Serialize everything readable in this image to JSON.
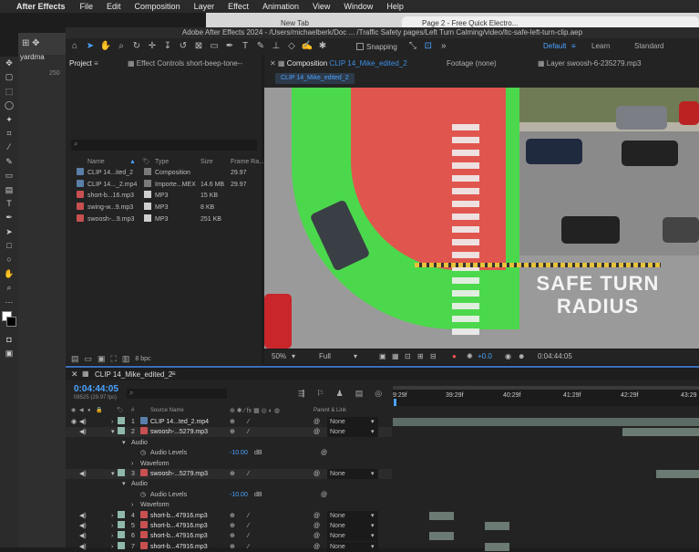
{
  "macmenu": {
    "apple": "",
    "app": "After Effects",
    "items": [
      "File",
      "Edit",
      "Composition",
      "Layer",
      "Effect",
      "Animation",
      "View",
      "Window",
      "Help"
    ]
  },
  "browser": {
    "tabs": [
      "New Tab",
      "Page 2 - Free Quick Electro..."
    ]
  },
  "ae": {
    "title": "Adobe After Effects 2024 - /Users/michaelberk/Doc ... /Traffic Safety pages/Left Turn Calming/video/ltc-safe-left-turn-clip.aep",
    "snapping": "Snapping",
    "workspaces": [
      "Default",
      "Learn",
      "Standard"
    ],
    "side_label": "yardma",
    "side_num": "250"
  },
  "project": {
    "tab": "Project",
    "effect_controls": "Effect Controls short-beep-tone--",
    "search_placeholder": "",
    "columns": [
      "Name",
      "Type",
      "Size",
      "Frame Ra..."
    ],
    "rows": [
      {
        "name": "CLIP 14...ited_2",
        "type": "Composition",
        "size": "",
        "fps": "29.97",
        "color": "#7a7a7a"
      },
      {
        "name": "CLIP 14..._2.mp4",
        "type": "Importe...MEX",
        "size": "14.6 MB",
        "fps": "29.97",
        "color": "#7a7a7a"
      },
      {
        "name": "short-b...16.mp3",
        "type": "MP3",
        "size": "15 KB",
        "fps": "",
        "color": "#cfcfcf"
      },
      {
        "name": "swing-w...9.mp3",
        "type": "MP3",
        "size": "8 KB",
        "fps": "",
        "color": "#cfcfcf"
      },
      {
        "name": "swoosh-...9.mp3",
        "type": "MP3",
        "size": "251 KB",
        "fps": "",
        "color": "#cfcfcf"
      }
    ],
    "bpc": "8 bpc"
  },
  "composition": {
    "tab": "Composition",
    "tab_name": "CLIP 14_Mike_edited_2",
    "footage": "Footage (none)",
    "layer_tab": "Layer swoosh-6-235279.mp3",
    "breadcrumb": "CLIP 14_Mike_edited_2",
    "overlay_line1": "SAFE TURN",
    "overlay_line2": "RADIUS",
    "zoom": "50%",
    "resolution": "Full",
    "exposure": "+0.0",
    "timecode": "0:04:44:05"
  },
  "timeline": {
    "tab": "CLIP 14_Mike_edited_2",
    "timecode": "0:04:44:05",
    "fps": "08525 (29.97 fps)",
    "col_source": "Source Name",
    "col_parent": "Parent & Link",
    "ruler": [
      "9:29f",
      "39:29f",
      "40:29f",
      "41:29f",
      "42:29f",
      "43:29"
    ],
    "rows": [
      {
        "kind": "layer",
        "num": "1",
        "name": "CLIP 14...ted_2.mp4",
        "parent": "None",
        "color": "#8fb8a8",
        "bar": [
          0,
          1
        ],
        "barcolor": "#5d6b66"
      },
      {
        "kind": "layer",
        "num": "2",
        "name": "swoosh-...5279.mp3",
        "parent": "None",
        "color": "#8fb8a8",
        "bar": [
          0.75,
          1
        ],
        "barcolor": "#6b7a72"
      },
      {
        "kind": "sub",
        "label": "Audio"
      },
      {
        "kind": "prop",
        "label": "Audio Levels",
        "value": "-10.00",
        "unit": "dB"
      },
      {
        "kind": "sub2",
        "label": "Waveform"
      },
      {
        "kind": "layer",
        "num": "3",
        "name": "swoosh-...5279.mp3",
        "parent": "None",
        "color": "#8fb8a8",
        "bar": [
          0.86,
          1
        ],
        "barcolor": "#6b7a72"
      },
      {
        "kind": "sub",
        "label": "Audio"
      },
      {
        "kind": "prop",
        "label": "Audio Levels",
        "value": "-10.00",
        "unit": "dB"
      },
      {
        "kind": "sub2",
        "label": "Waveform"
      },
      {
        "kind": "layer",
        "num": "4",
        "name": "short-b...47916.mp3",
        "parent": "None",
        "color": "#8fb8a8",
        "bar": [
          0.12,
          0.2
        ],
        "barcolor": "#6b7a72"
      },
      {
        "kind": "layer",
        "num": "5",
        "name": "short-b...47916.mp3",
        "parent": "None",
        "color": "#8fb8a8",
        "bar": [
          0.3,
          0.38
        ],
        "barcolor": "#6b7a72"
      },
      {
        "kind": "layer",
        "num": "6",
        "name": "short-b...47916.mp3",
        "parent": "None",
        "color": "#8fb8a8",
        "bar": [
          0.12,
          0.2
        ],
        "barcolor": "#6b7a72"
      },
      {
        "kind": "layer",
        "num": "7",
        "name": "short-b...47916.mp3",
        "parent": "None",
        "color": "#8fb8a8",
        "bar": [
          0.3,
          0.38
        ],
        "barcolor": "#6b7a72"
      }
    ]
  }
}
